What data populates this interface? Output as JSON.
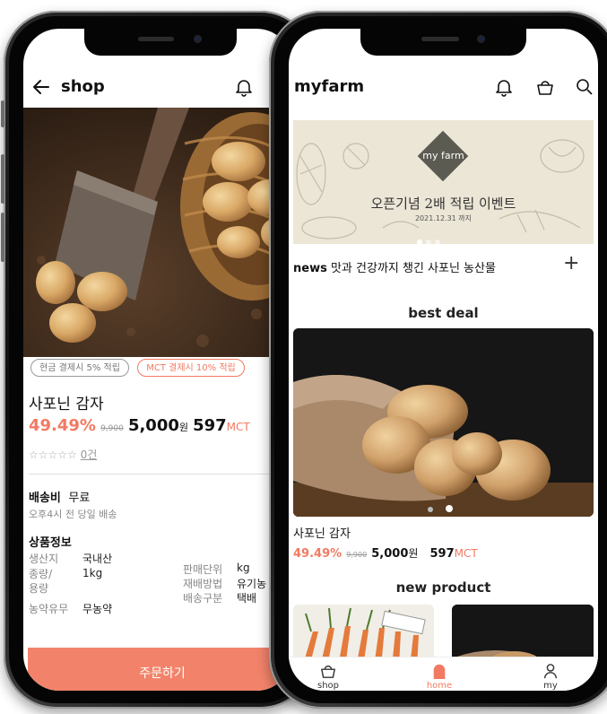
{
  "left": {
    "header": {
      "title": "shop",
      "back_icon": "arrow-left-icon",
      "bell_icon": "bell-icon"
    },
    "chips": [
      {
        "label": "현금 결제시 5% 적립",
        "color": "#999999"
      },
      {
        "label": "MCT 결제시 10% 적립",
        "color": "#f27a62"
      }
    ],
    "product": {
      "name": "사포닌 감자",
      "discount": "49.49%",
      "original_price": "9,900",
      "price": "5,000",
      "price_unit": "원",
      "mct": "597",
      "mct_unit": "MCT",
      "stars": "☆☆☆☆☆",
      "review_count": "0건"
    },
    "shipping": {
      "label": "배송비",
      "value": "무료",
      "note": "오후4시 전 당일 배송"
    },
    "info": {
      "title": "상품정보",
      "rows_left": [
        {
          "label": "생산지",
          "value": "국내산"
        },
        {
          "label": "종량/\n용량",
          "value": "1kg"
        },
        {
          "label": "농약유무",
          "value": "무농약"
        }
      ],
      "rows_right": [
        {
          "label": "판매단위",
          "value": "kg"
        },
        {
          "label": "재배방법",
          "value": "유기농"
        },
        {
          "label": "배송구분",
          "value": "택배"
        }
      ]
    },
    "order_button": "주문하기"
  },
  "right": {
    "header": {
      "title": "myfarm",
      "icons": [
        "bell-icon",
        "basket-icon",
        "search-icon"
      ]
    },
    "banner": {
      "logo": "my farm",
      "headline": "오픈기념 2배 적립 이벤트",
      "date": "2021.12.31 까지"
    },
    "news": {
      "tag": "news",
      "text": "맛과 건강까지 챙긴 사포닌 농산물",
      "plus": "+"
    },
    "best_deal": {
      "title": "best deal",
      "product": {
        "name": "사포닌 감자",
        "discount": "49.49%",
        "original_price": "9,900",
        "price": "5,000",
        "price_unit": "원",
        "mct": "597",
        "mct_unit": "MCT"
      }
    },
    "new_product": {
      "title": "new product"
    },
    "tabbar": [
      {
        "label": "shop",
        "icon": "basket-icon",
        "active": false
      },
      {
        "label": "home",
        "icon": "home-icon",
        "active": true
      },
      {
        "label": "my",
        "icon": "user-icon",
        "active": false
      }
    ],
    "accent": "#f27a62"
  }
}
